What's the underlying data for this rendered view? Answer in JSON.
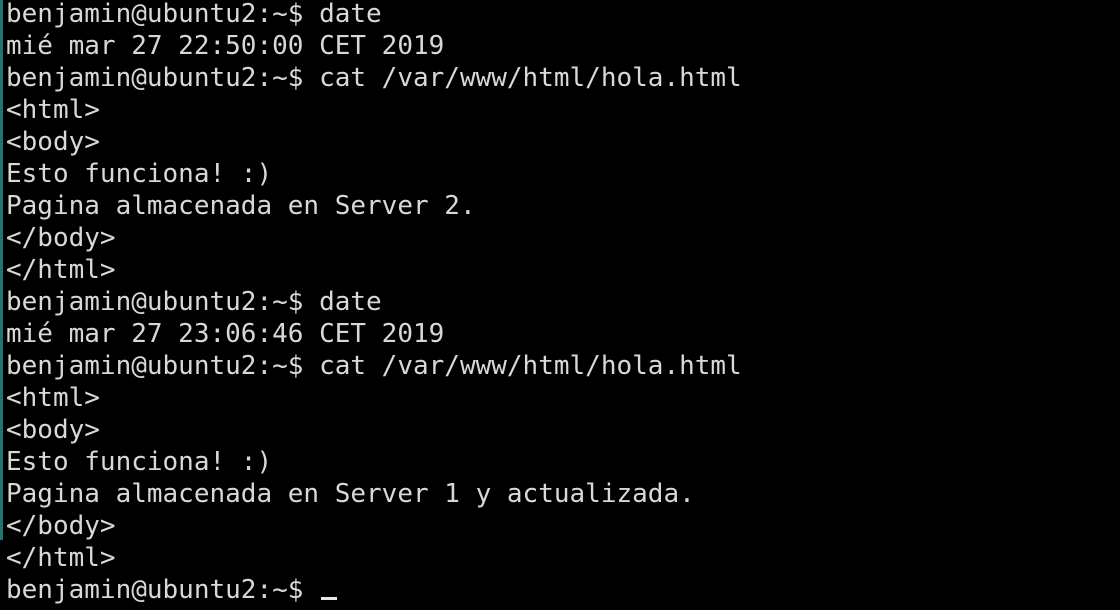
{
  "terminal": {
    "lines": [
      "benjamin@ubuntu2:~$ date",
      "mié mar 27 22:50:00 CET 2019",
      "benjamin@ubuntu2:~$ cat /var/www/html/hola.html",
      "<html>",
      "<body>",
      "Esto funciona! :)",
      "Pagina almacenada en Server 2.",
      "</body>",
      "</html>",
      "benjamin@ubuntu2:~$ date",
      "mié mar 27 23:06:46 CET 2019",
      "benjamin@ubuntu2:~$ cat /var/www/html/hola.html",
      "<html>",
      "<body>",
      "Esto funciona! :)",
      "Pagina almacenada en Server 1 y actualizada.",
      "</body>",
      "</html>"
    ],
    "prompt": "benjamin@ubuntu2:~$ ",
    "colors": {
      "background": "#000000",
      "foreground": "#d8d8d8"
    }
  }
}
